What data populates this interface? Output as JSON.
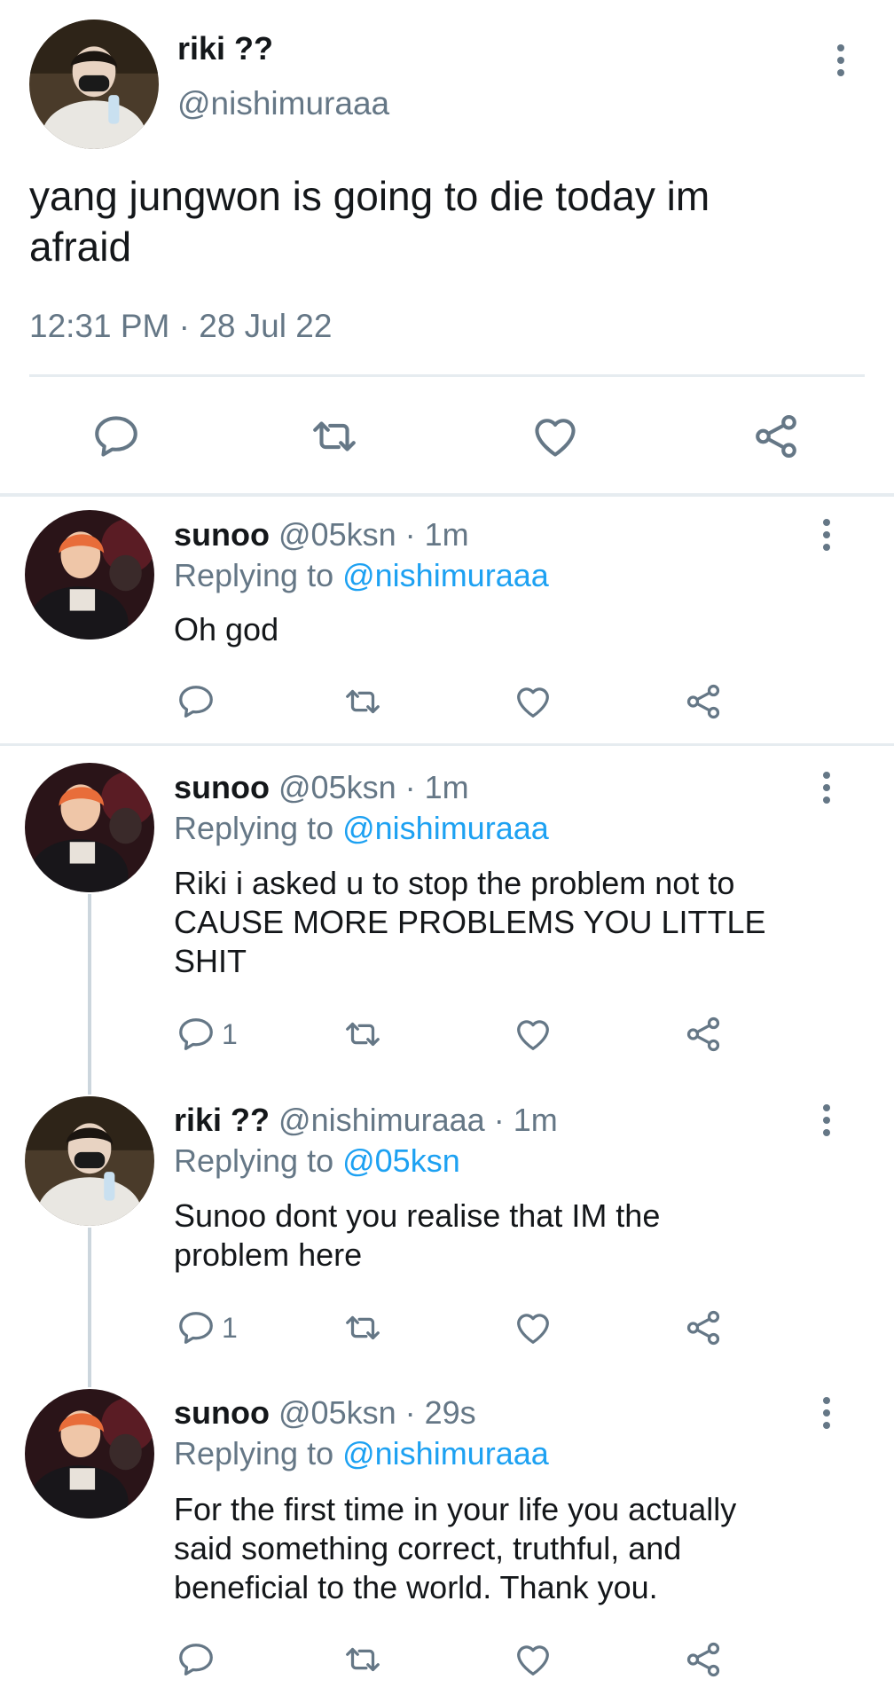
{
  "main_tweet": {
    "display_name": "riki ??",
    "handle": "@nishimuraaa",
    "text": "yang jungwon is going to die today im afraid",
    "timestamp": "12:31 PM · 28 Jul 22"
  },
  "replies": [
    {
      "name": "sunoo",
      "handle": "@05ksn",
      "sep": " · ",
      "time": "1m",
      "replying_label": "Replying to ",
      "replying_to": "@nishimuraaa",
      "text_lines": [
        "Oh god"
      ],
      "reply_count": ""
    },
    {
      "name": "sunoo",
      "handle": "@05ksn",
      "sep": " · ",
      "time": "1m",
      "replying_label": "Replying to ",
      "replying_to": "@nishimuraaa",
      "text_lines": [
        "Riki i asked u to stop the problem not to",
        "CAUSE MORE PROBLEMS YOU LITTLE",
        "SHIT"
      ],
      "reply_count": "1"
    },
    {
      "name": "riki ??",
      "handle": "@nishimuraaa",
      "sep": " · ",
      "time": "1m",
      "replying_label": "Replying to ",
      "replying_to": "@05ksn",
      "text_lines": [
        "Sunoo dont you realise that IM the",
        "problem here"
      ],
      "reply_count": "1"
    },
    {
      "name": "sunoo",
      "handle": "@05ksn",
      "sep": " · ",
      "time": "29s",
      "replying_label": "Replying to ",
      "replying_to": "@nishimuraaa",
      "text_lines": [
        "For the first time in your life you actually",
        "said something correct, truthful, and",
        "beneficial to the world. Thank you."
      ],
      "reply_count": ""
    }
  ],
  "icons": [
    "reply-icon",
    "retweet-icon",
    "like-icon",
    "share-icon",
    "more-options-icon"
  ],
  "colors": {
    "link": "#1da1f2",
    "muted": "#657786",
    "text": "#14171a",
    "divider": "#e6ecf0"
  }
}
